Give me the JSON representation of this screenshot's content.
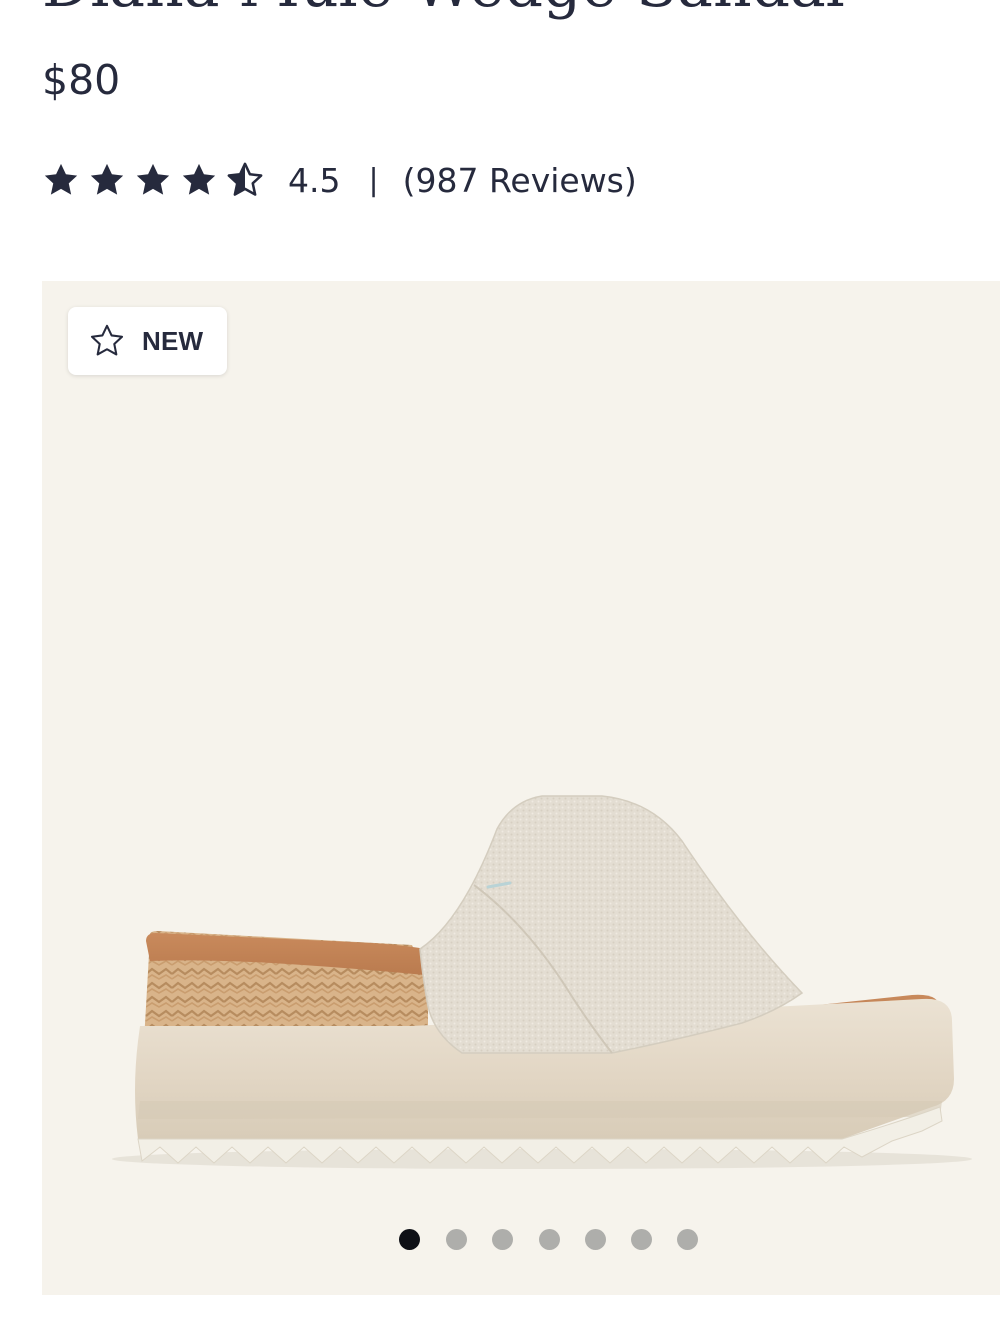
{
  "product": {
    "title": "Diana Mule Wedge Sandal",
    "price": "$80",
    "rating": {
      "value": "4.5",
      "stars": 4.5,
      "max_stars": 5,
      "separator": "|",
      "reviews": "(987 Reviews)"
    }
  },
  "gallery": {
    "badge": {
      "label": "NEW",
      "icon": "star-outline-icon"
    },
    "image_name": "diana-mule-wedge-sandal",
    "slide_count": 7,
    "active_slide": 1
  },
  "colors": {
    "text": "#262a3d",
    "gallery_bg": "#f6f3ec",
    "dot_active": "#0e1016",
    "dot_inactive": "#aeaeab"
  }
}
